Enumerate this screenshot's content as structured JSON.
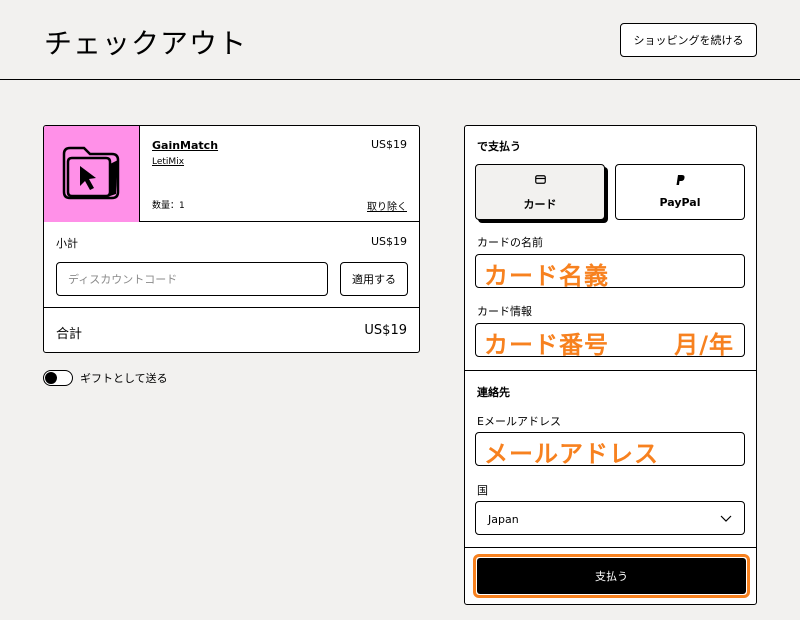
{
  "header": {
    "title": "チェックアウト",
    "continue_label": "ショッピングを続ける"
  },
  "cart": {
    "item": {
      "name": "GainMatch",
      "seller": "LetiMix",
      "price": "US$19",
      "qty_label": "数量：",
      "qty": "1",
      "remove_label": "取り除く"
    },
    "subtotal_label": "小計",
    "subtotal_value": "US$19",
    "discount_placeholder": "ディスカウントコード",
    "apply_label": "適用する",
    "total_label": "合計",
    "total_value": "US$19"
  },
  "gift": {
    "label": "ギフトとして送る"
  },
  "payment": {
    "title": "で支払う",
    "methods": [
      {
        "label": "カード",
        "icon": "card-icon"
      },
      {
        "label": "PayPal",
        "icon": "paypal-icon"
      }
    ],
    "card_name_label": "カードの名前",
    "card_name_value": "カード名義",
    "card_info_label": "カード情報",
    "card_number_value": "カード番号",
    "card_expiry_value": "月/年",
    "contact_title": "連絡先",
    "email_label": "Eメールアドレス",
    "email_value": "メールアドレス",
    "country_label": "国",
    "country_value": "Japan",
    "pay_label": "支払う"
  },
  "colors": {
    "background": "#f2f1ef",
    "thumbnail": "#ff90e8",
    "annotation": "#f7811f"
  }
}
